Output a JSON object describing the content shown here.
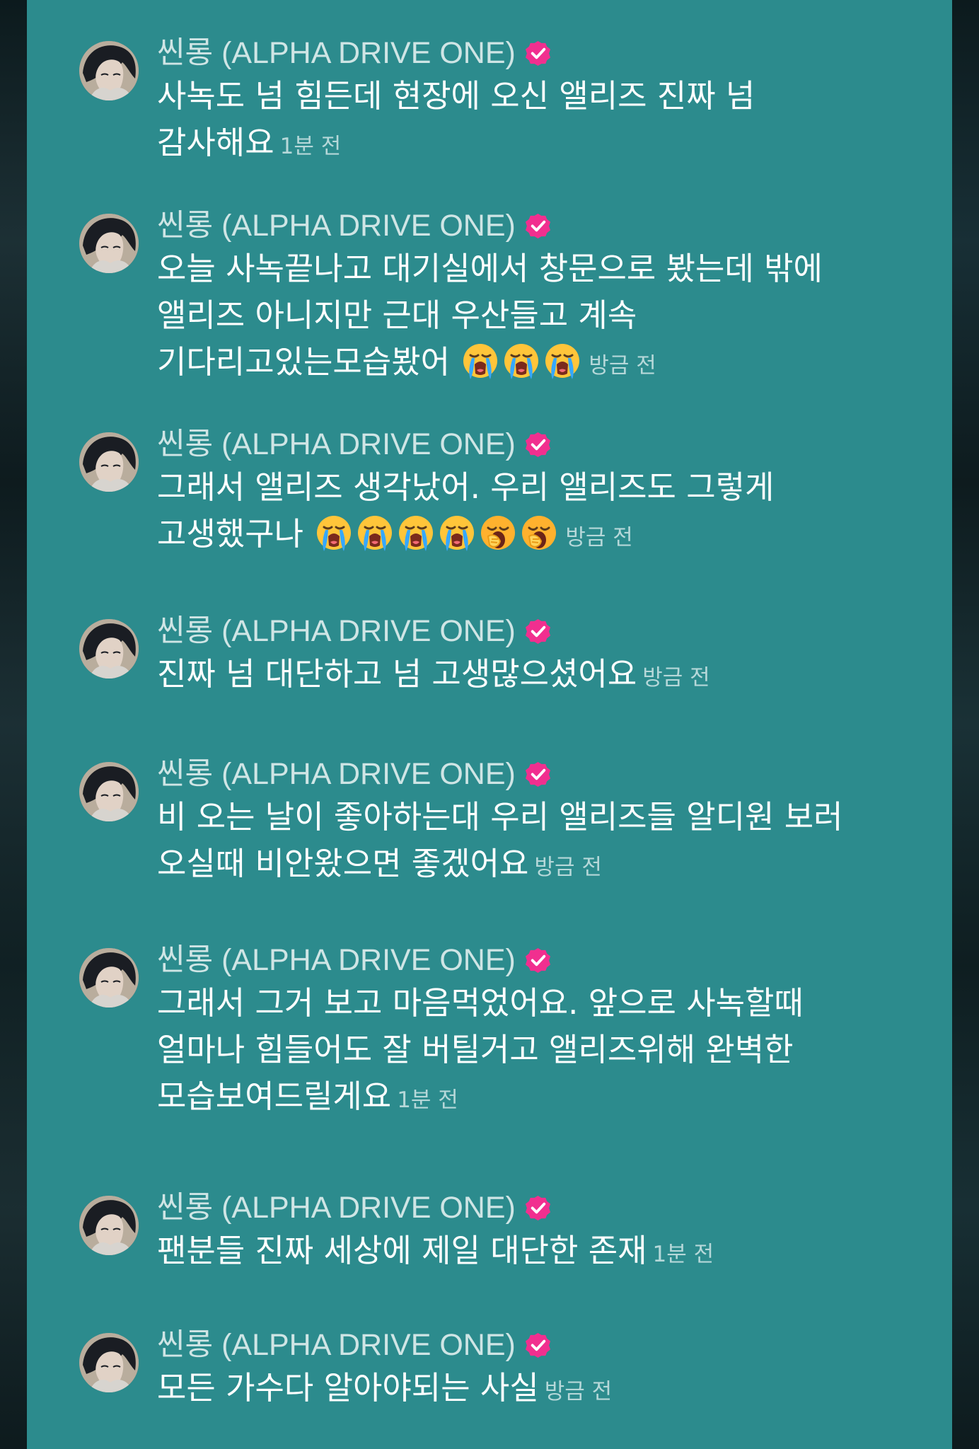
{
  "theme": {
    "panel_color": "#2c8b8d",
    "name_color": "#cfe5e5",
    "text_color": "#ffffff",
    "time_color": "#b6d8d9",
    "verified_color": "#f12f8f"
  },
  "messages": [
    {
      "author": "씬롱 (ALPHA DRIVE ONE)",
      "text": "사녹도 넘 힘든데 현장에 오신 앨리즈 진짜 넘 감사해요",
      "time": "1분 전",
      "emojis": []
    },
    {
      "author": "씬롱 (ALPHA DRIVE ONE)",
      "text": "오늘 사녹끝나고 대기실에서 창문으로 봤는데 밖에 앨리즈 아니지만 근대 우산들고 계속 기다리고있는모습봤어",
      "time": "방금 전",
      "emojis": [
        "loudly-crying-face",
        "loudly-crying-face",
        "loudly-crying-face"
      ]
    },
    {
      "author": "씬롱 (ALPHA DRIVE ONE)",
      "text": "그래서 앨리즈 생각났어. 우리 앨리즈도 그렇게 고생했구나",
      "time": "방금 전",
      "emojis": [
        "loudly-crying-face",
        "loudly-crying-face",
        "loudly-crying-face",
        "loudly-crying-face",
        "yawning-face",
        "yawning-face"
      ]
    },
    {
      "author": "씬롱 (ALPHA DRIVE ONE)",
      "text": "진짜 넘 대단하고 넘 고생많으셨어요",
      "time": "방금 전",
      "emojis": []
    },
    {
      "author": "씬롱 (ALPHA DRIVE ONE)",
      "text": "비 오는 날이 좋아하는대 우리 앨리즈들 알디원 보러 오실때 비안왔으면 좋겠어요",
      "time": "방금 전",
      "emojis": []
    },
    {
      "author": "씬롱 (ALPHA DRIVE ONE)",
      "text": "그래서 그거 보고 마음먹었어요. 앞으로 사녹할때 얼마나 힘들어도 잘 버틸거고 앨리즈위해 완벽한 모습보여드릴게요",
      "time": "1분 전",
      "emojis": []
    },
    {
      "author": "씬롱 (ALPHA DRIVE ONE)",
      "text": "팬분들 진짜 세상에 제일 대단한 존재",
      "time": "1분 전",
      "emojis": []
    },
    {
      "author": "씬롱 (ALPHA DRIVE ONE)",
      "text": "모든 가수다 알아야되는 사실",
      "time": "방금 전",
      "emojis": []
    }
  ]
}
